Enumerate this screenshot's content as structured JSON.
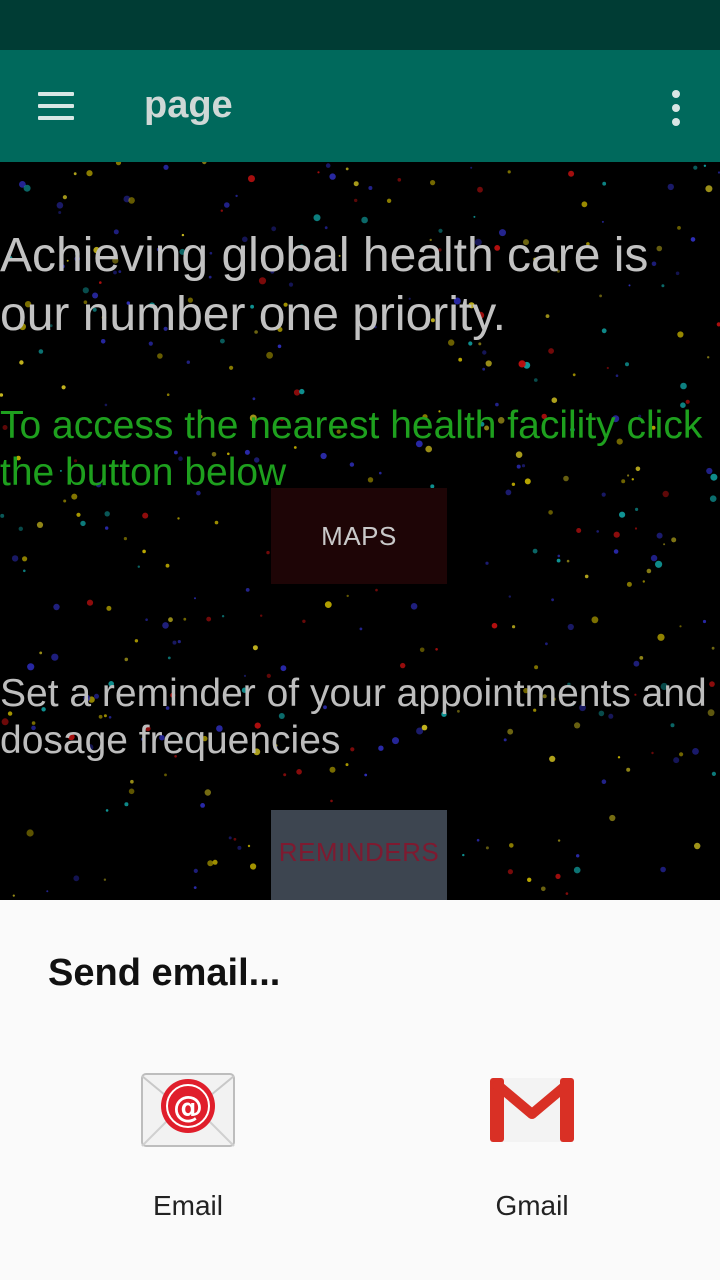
{
  "app_bar": {
    "title": "page"
  },
  "content": {
    "headline": "Achieving global health care is our number one priority.",
    "maps_prompt": "To access the nearest health facility click the button below",
    "maps_button": "MAPS",
    "reminder_prompt": "Set a reminder of your appointments and dosage frequencies",
    "reminders_button": "REMINDERS"
  },
  "share_sheet": {
    "title": "Send email...",
    "targets": [
      {
        "label": "Email",
        "icon": "email-app-icon"
      },
      {
        "label": "Gmail",
        "icon": "gmail-app-icon"
      }
    ]
  },
  "colors": {
    "status_bar": "#003c34",
    "app_bar": "#00695c",
    "green_text": "#1ea01e"
  }
}
